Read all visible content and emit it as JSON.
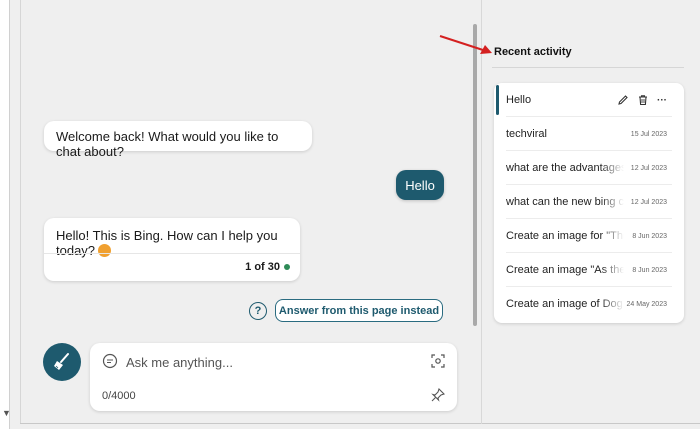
{
  "chat": {
    "welcome_message": "Welcome back! What would you like to chat about?",
    "user_message": "Hello",
    "bot_reply": "Hello! This is Bing. How can I help you today?",
    "reply_counter": "1 of 30"
  },
  "actions": {
    "answer_from_page_label": "Answer from this page instead",
    "help_glyph": "?"
  },
  "input": {
    "placeholder": "Ask me anything...",
    "char_count": "0/4000"
  },
  "recent": {
    "title": "Recent activity",
    "items": [
      {
        "title": "Hello",
        "date": ""
      },
      {
        "title": "techviral",
        "date": "15 Jul 2023"
      },
      {
        "title": "what are the advantages",
        "date": "12 Jul 2023"
      },
      {
        "title": "what can the new bing c",
        "date": "12 Jul 2023"
      },
      {
        "title": "Create an image for \"The",
        "date": "8 Jun 2023"
      },
      {
        "title": "Create an image \"As the",
        "date": "8 Jun 2023"
      },
      {
        "title": "Create an image of Dog",
        "date": "24 May 2023"
      }
    ],
    "more_glyph": "···"
  },
  "colors": {
    "accent": "#1e5a6e",
    "annotation_arrow": "#d42020",
    "status_dot": "#2e8b57"
  }
}
